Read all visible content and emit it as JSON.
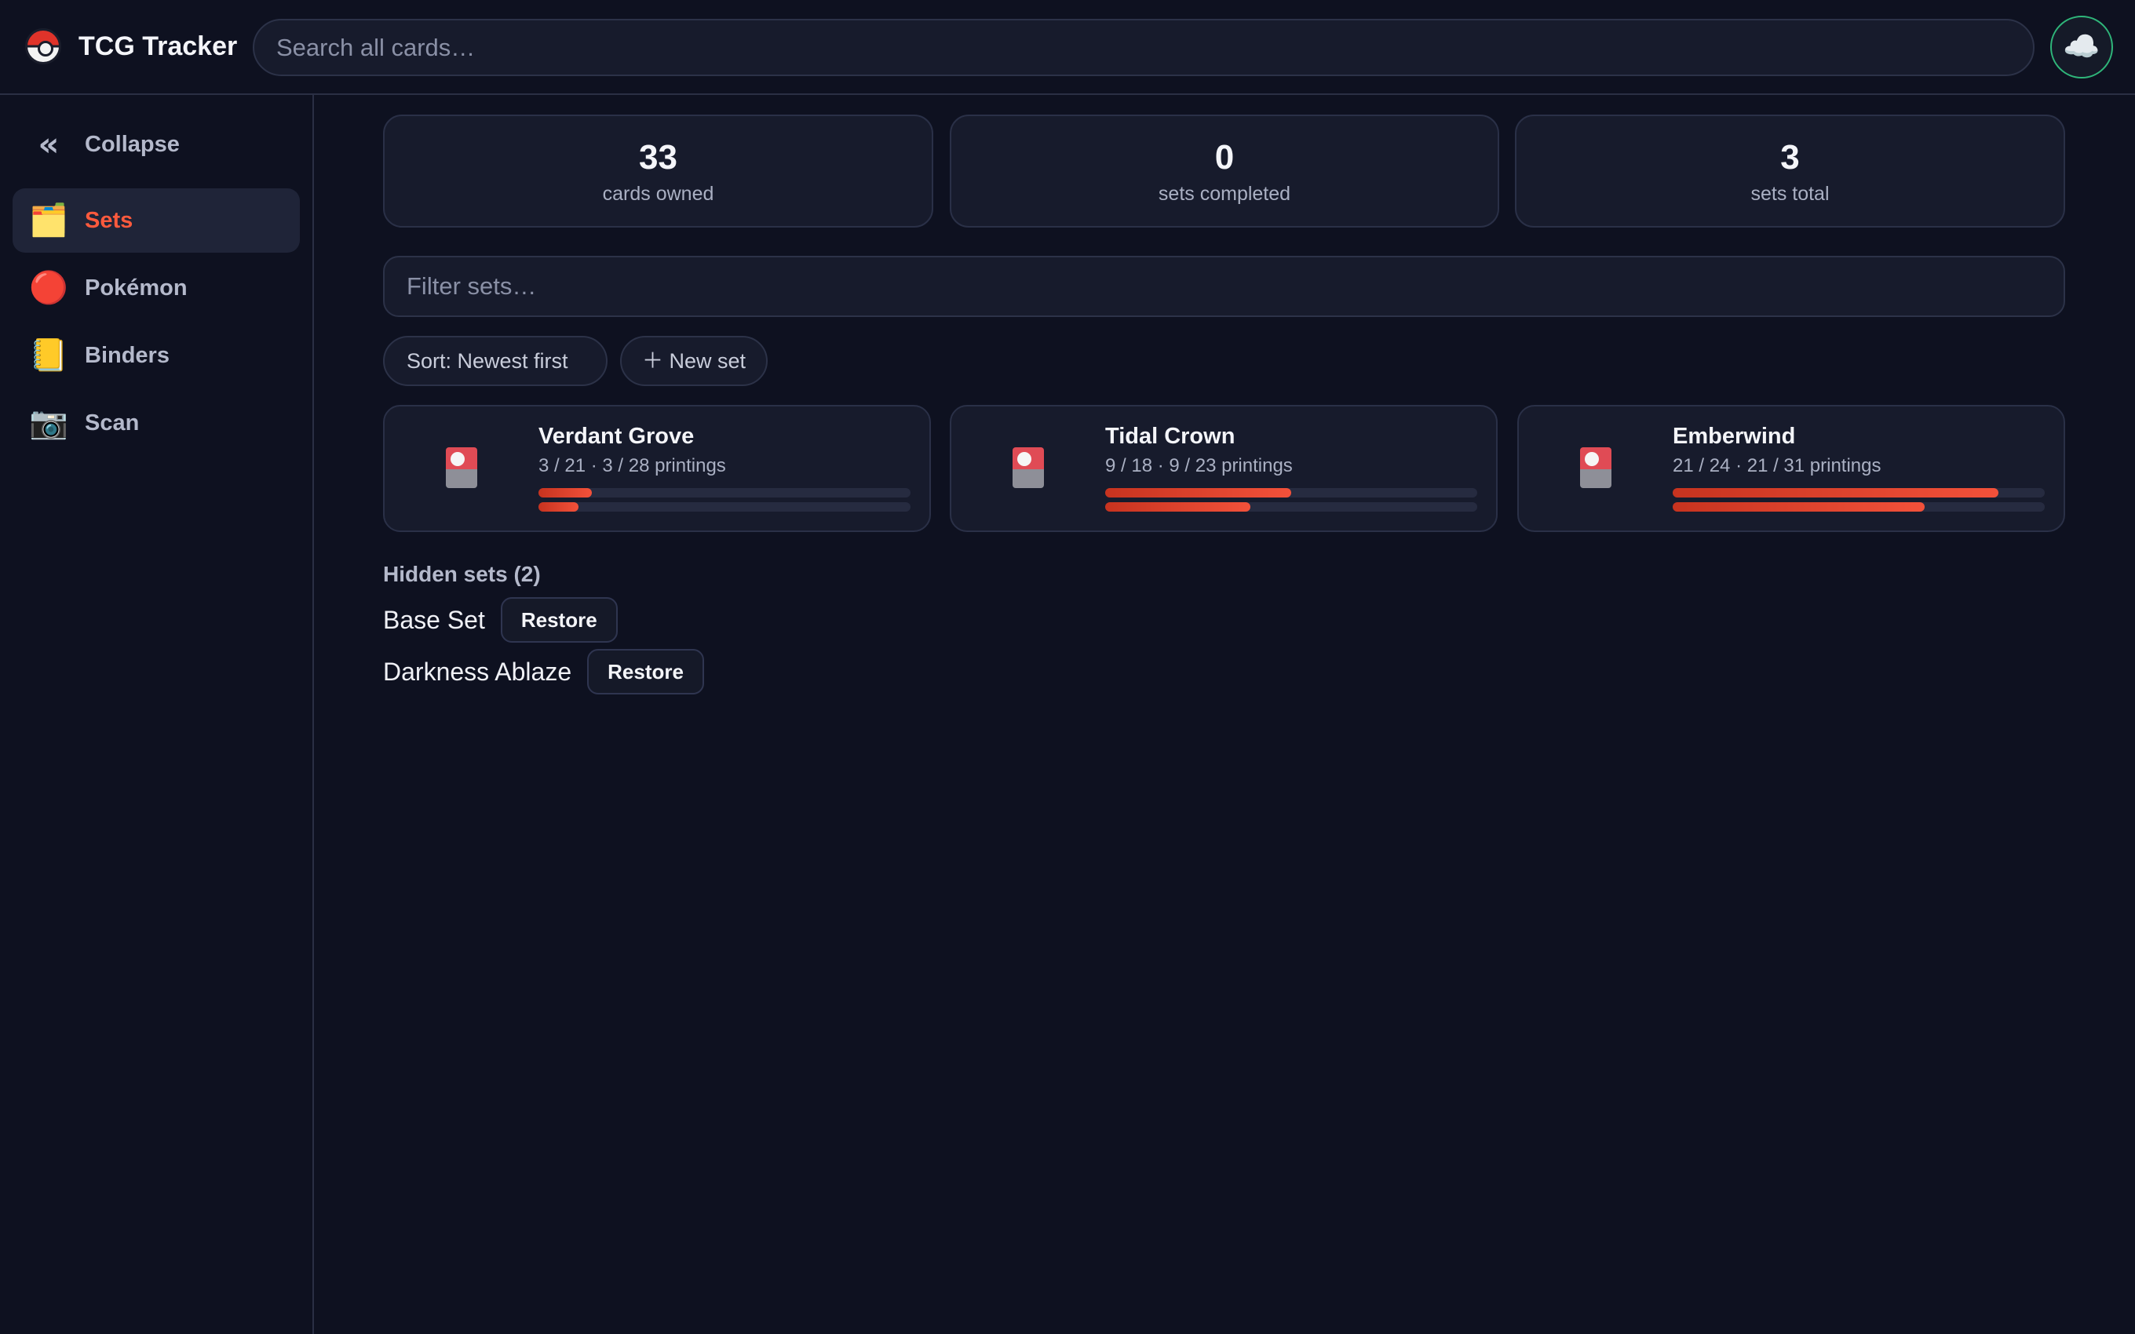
{
  "header": {
    "app_title": "TCG Tracker",
    "search_placeholder": "Search all cards…",
    "logo_icon": "pokeball-icon",
    "cloud_icon": "cloud-icon",
    "accent_color": "#ff5a3d",
    "sync_ring_color": "#2fb67a"
  },
  "sidebar": {
    "collapse_label": "Collapse",
    "items": [
      {
        "label": "Sets",
        "icon": "🗂️",
        "icon_name": "folder-icon",
        "active": true
      },
      {
        "label": "Pokémon",
        "icon": "🔴",
        "icon_name": "red-circle-icon",
        "active": false
      },
      {
        "label": "Binders",
        "icon": "📒",
        "icon_name": "ledger-icon",
        "active": false
      },
      {
        "label": "Scan",
        "icon": "📷",
        "icon_name": "camera-icon",
        "active": false
      }
    ]
  },
  "stats": [
    {
      "value": "33",
      "label": "cards owned"
    },
    {
      "value": "0",
      "label": "sets completed"
    },
    {
      "value": "3",
      "label": "sets total"
    }
  ],
  "filter_placeholder": "Filter sets…",
  "sort_label": "Sort: Newest first",
  "new_set_label": "＋ New set",
  "sets": [
    {
      "name": "Verdant Grove",
      "progress_text": "3 / 21 · 3 / 28 printings",
      "cards_owned": 3,
      "cards_total": 21,
      "printings_owned": 3,
      "printings_total": 28
    },
    {
      "name": "Tidal Crown",
      "progress_text": "9 / 18 · 9 / 23 printings",
      "cards_owned": 9,
      "cards_total": 18,
      "printings_owned": 9,
      "printings_total": 23
    },
    {
      "name": "Emberwind",
      "progress_text": "21 / 24 · 21 / 31 printings",
      "cards_owned": 21,
      "cards_total": 24,
      "printings_owned": 21,
      "printings_total": 31
    }
  ],
  "hidden": {
    "title": "Hidden sets (2)",
    "items": [
      {
        "name": "Base Set",
        "button": "Restore"
      },
      {
        "name": "Darkness Ablaze",
        "button": "Restore"
      }
    ]
  }
}
